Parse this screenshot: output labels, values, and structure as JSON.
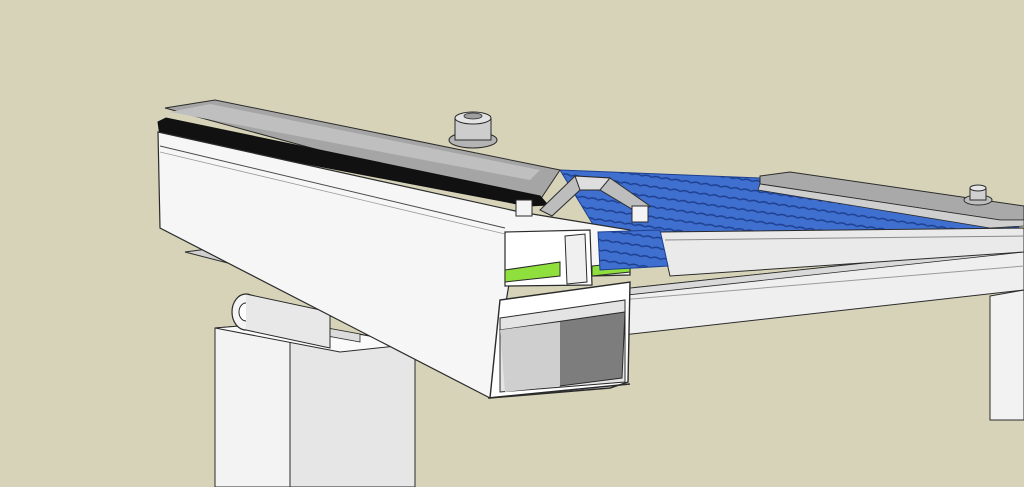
{
  "colors": {
    "background": "#d6d3b9",
    "profile_white": "#f4f4f4",
    "profile_shade": "#d9d9d9",
    "profile_dark": "#8a8a8a",
    "aluminium_top": "#a6a6a6",
    "aluminium_light": "#c4c4c4",
    "gasket_black": "#111111",
    "glazing_blue": "#3f6fcf",
    "glazing_blue_dark": "#1d3f8f",
    "seal_green": "#8fe03c",
    "outline": "#2b2b2b"
  },
  "icons": {
    "bolt": "hex-bolt-icon",
    "pipe": "round-pipe-icon"
  }
}
